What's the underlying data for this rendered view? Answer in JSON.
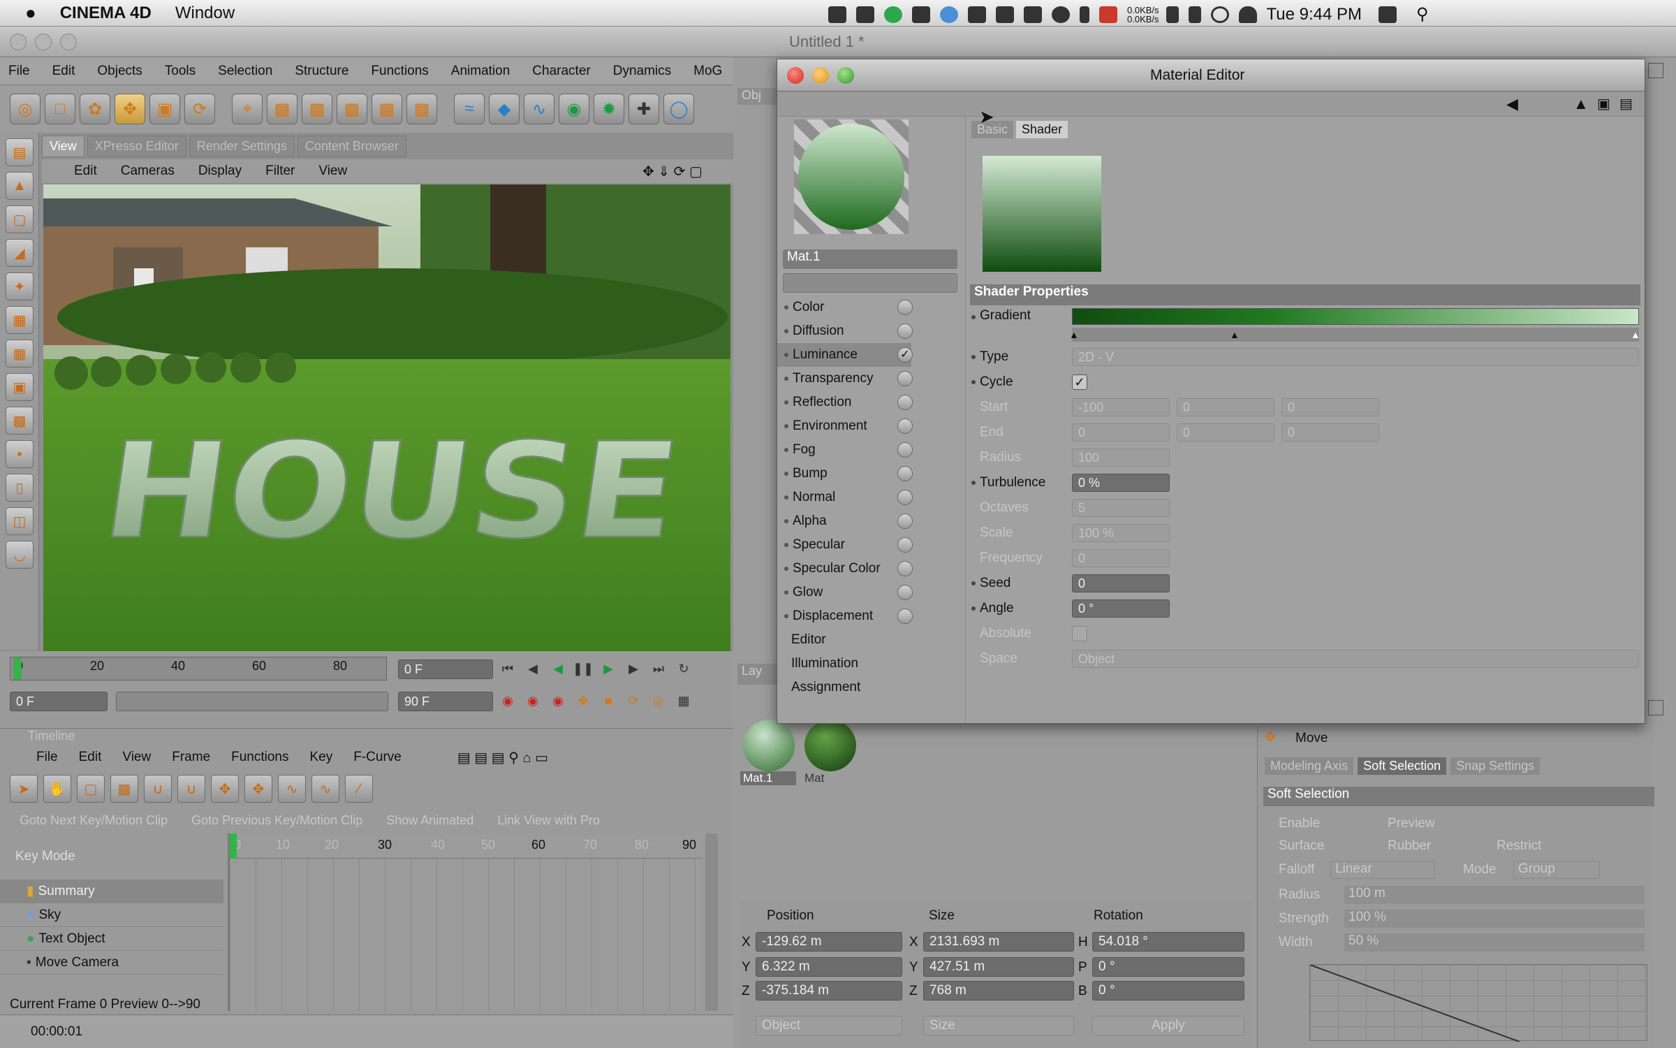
{
  "menubar": {
    "app_name": "CINEMA 4D",
    "window_menu": "Window",
    "net_up": "0.0KB/s",
    "net_down": "0.0KB/s",
    "clock": "Tue 9:44 PM"
  },
  "titlebar": {
    "title": "Untitled 1 *"
  },
  "app_menu": [
    "File",
    "Edit",
    "Objects",
    "Tools",
    "Selection",
    "Structure",
    "Functions",
    "Animation",
    "Character",
    "Dynamics",
    "MoG"
  ],
  "viewport_tabs": [
    "View",
    "XPresso Editor",
    "Render Settings",
    "Content Browser"
  ],
  "viewport_menu": [
    "Edit",
    "Cameras",
    "Display",
    "Filter",
    "View"
  ],
  "viewport_text": "HOUSE",
  "ruler": {
    "ticks": [
      "0",
      "20",
      "40",
      "60",
      "80"
    ]
  },
  "frame_fields": {
    "current": "0 F",
    "start": "0 F",
    "end": "90 F"
  },
  "timeline": {
    "title": "Timeline",
    "menu": [
      "File",
      "Edit",
      "View",
      "Frame",
      "Functions",
      "Key",
      "F-Curve"
    ],
    "hints": [
      "Goto Next Key/Motion Clip",
      "Goto Previous Key/Motion Clip",
      "Show Animated",
      "Link View with Pro"
    ],
    "key_mode": "Key Mode",
    "ticks": [
      "0",
      "10",
      "20",
      "30",
      "40",
      "50",
      "60",
      "70",
      "80",
      "90"
    ],
    "rows": [
      "Summary",
      "Sky",
      "Text Object",
      "Move Camera"
    ],
    "status": "Current Frame  0  Preview  0-->90"
  },
  "statusbar": {
    "time": "00:00:01"
  },
  "side_tab": "Obj",
  "material_manager": {
    "tab": "Lay",
    "materials": [
      "Mat.1",
      "Mat"
    ]
  },
  "coords": {
    "headers": [
      "Position",
      "Size",
      "Rotation"
    ],
    "axes": [
      "X",
      "Y",
      "Z"
    ],
    "size_axes": [
      "X",
      "Y",
      "Z"
    ],
    "rot_axes": [
      "H",
      "P",
      "B"
    ],
    "position": [
      "-129.62 m",
      "6.322 m",
      "-375.184 m"
    ],
    "size": [
      "2131.693 m",
      "427.51 m",
      "768 m"
    ],
    "rotation": [
      "54.018 °",
      "0 °",
      "0 °"
    ],
    "mode1": "Object",
    "mode2": "Size",
    "apply": "Apply"
  },
  "attributes": {
    "title": "Move",
    "tabs": [
      "Modeling Axis",
      "Soft Selection",
      "Snap Settings"
    ],
    "section": "Soft Selection",
    "opts": [
      "Enable",
      "Preview",
      "Surface",
      "Rubber",
      "Restrict"
    ],
    "falloff_label": "Falloff",
    "falloff": "Linear",
    "mode_label": "Mode",
    "mode": "Group",
    "sliders": [
      {
        "label": "Radius",
        "value": "100 m"
      },
      {
        "label": "Strength",
        "value": "100 %"
      },
      {
        "label": "Width",
        "value": "50 %"
      }
    ]
  },
  "material_editor": {
    "title": "Material Editor",
    "material_name": "Mat.1",
    "tabs": [
      "Basic",
      "Shader"
    ],
    "channels": [
      "Color",
      "Diffusion",
      "Luminance",
      "Transparency",
      "Reflection",
      "Environment",
      "Fog",
      "Bump",
      "Normal",
      "Alpha",
      "Specular",
      "Specular Color",
      "Glow",
      "Displacement"
    ],
    "channel_checked": "Luminance",
    "extra": [
      "Editor",
      "Illumination",
      "Assignment"
    ],
    "section": "Shader Properties",
    "gradient_label": "Gradient",
    "props": {
      "type_label": "Type",
      "type": "2D - V",
      "cycle_label": "Cycle",
      "start_label": "Start",
      "start": [
        "-100",
        "0",
        "0"
      ],
      "end_label": "End",
      "end": [
        "0",
        "0",
        "0"
      ],
      "radius_label": "Radius",
      "radius": "100",
      "turbulence_label": "Turbulence",
      "turbulence": "0 %",
      "octaves_label": "Octaves",
      "octaves": "5",
      "scale_label": "Scale",
      "scale": "100 %",
      "frequency_label": "Frequency",
      "frequency": "0",
      "seed_label": "Seed",
      "seed": "0",
      "angle_label": "Angle",
      "angle": "0 °",
      "absolute_label": "Absolute",
      "space_label": "Space",
      "space": "Object"
    }
  },
  "colors": {
    "gradient_dark": "#0f4d0f",
    "gradient_light": "#c9e6c9",
    "accent_orange": "#d07a1c"
  }
}
